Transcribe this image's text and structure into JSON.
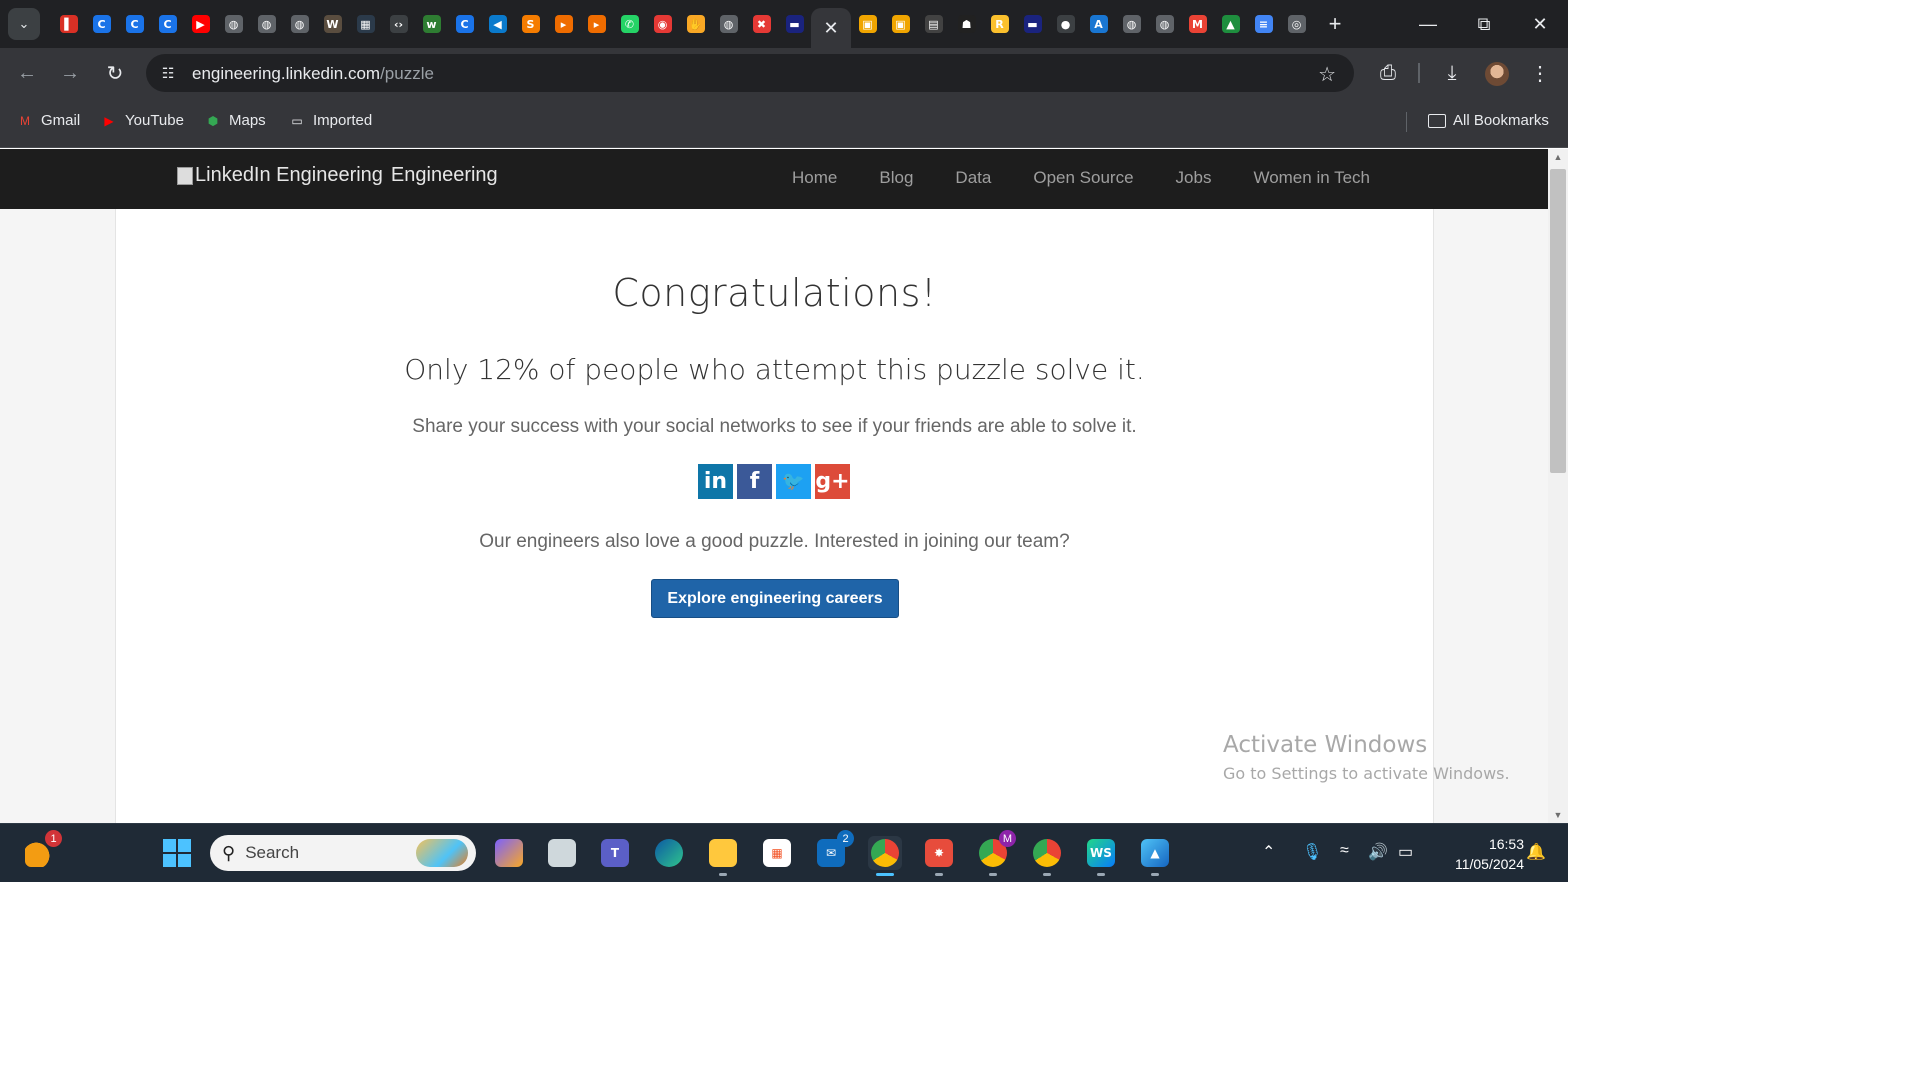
{
  "browser": {
    "tab_strip": {
      "tab_search_label": "⌄",
      "new_tab_label": "+",
      "active_tab_close": "✕",
      "tab_favicons_before": [
        {
          "icon": "pdf-icon",
          "glyph": "▌",
          "color": "#d93025"
        },
        {
          "icon": "c-icon",
          "glyph": "C",
          "color": "#1a73e8"
        },
        {
          "icon": "c-icon",
          "glyph": "C",
          "color": "#1a73e8"
        },
        {
          "icon": "c-icon",
          "glyph": "C",
          "color": "#1a73e8"
        },
        {
          "icon": "youtube-icon",
          "glyph": "▶",
          "color": "#ff0000"
        },
        {
          "icon": "globe-icon",
          "glyph": "◍",
          "color": "#5f6368"
        },
        {
          "icon": "globe-icon",
          "glyph": "◍",
          "color": "#5f6368"
        },
        {
          "icon": "globe-icon",
          "glyph": "◍",
          "color": "#5f6368"
        },
        {
          "icon": "site-icon",
          "glyph": "W",
          "color": "#5a4d3f"
        },
        {
          "icon": "site-icon",
          "glyph": "▦",
          "color": "#2b3a4a"
        },
        {
          "icon": "code-icon",
          "glyph": "‹›",
          "color": "#3c4043"
        },
        {
          "icon": "w-icon",
          "glyph": "w",
          "color": "#2e7d32"
        },
        {
          "icon": "c-icon",
          "glyph": "C",
          "color": "#1a73e8"
        },
        {
          "icon": "vscode-icon",
          "glyph": "◀",
          "color": "#0a7acc"
        },
        {
          "icon": "s-icon",
          "glyph": "S",
          "color": "#f57c00"
        },
        {
          "icon": "arrow-icon",
          "glyph": "▸",
          "color": "#ef6c00"
        },
        {
          "icon": "arrow-icon",
          "glyph": "▸",
          "color": "#ef6c00"
        },
        {
          "icon": "whatsapp-icon",
          "glyph": "✆",
          "color": "#25d366"
        },
        {
          "icon": "record-icon",
          "glyph": "◉",
          "color": "#e53935"
        },
        {
          "icon": "hand-icon",
          "glyph": "✋",
          "color": "#f9a825"
        },
        {
          "icon": "globe-icon",
          "glyph": "◍",
          "color": "#5f6368"
        },
        {
          "icon": "x-icon",
          "glyph": "✖",
          "color": "#e53935"
        },
        {
          "icon": "site-icon",
          "glyph": "▬",
          "color": "#1a237e"
        }
      ],
      "tab_favicons_after": [
        {
          "icon": "site-icon",
          "glyph": "▣",
          "color": "#f0a500"
        },
        {
          "icon": "site-icon",
          "glyph": "▣",
          "color": "#f0a500"
        },
        {
          "icon": "site-icon",
          "glyph": "▤",
          "color": "#424242"
        },
        {
          "icon": "site-icon",
          "glyph": "☗",
          "color": "#212121"
        },
        {
          "icon": "r-icon",
          "glyph": "R",
          "color": "#fbc02d"
        },
        {
          "icon": "site-icon",
          "glyph": "▬",
          "color": "#1a237e"
        },
        {
          "icon": "github-icon",
          "glyph": "●",
          "color": "#3c4043"
        },
        {
          "icon": "a-icon",
          "glyph": "A",
          "color": "#1976d2"
        },
        {
          "icon": "globe-icon",
          "glyph": "◍",
          "color": "#5f6368"
        },
        {
          "icon": "globe-icon",
          "glyph": "◍",
          "color": "#5f6368"
        },
        {
          "icon": "gmail-icon",
          "glyph": "M",
          "color": "#ea4335"
        },
        {
          "icon": "drive-icon",
          "glyph": "▲",
          "color": "#1e8e3e"
        },
        {
          "icon": "docs-icon",
          "glyph": "≡",
          "color": "#4285f4"
        },
        {
          "icon": "chrome-icon",
          "glyph": "◎",
          "color": "#5f6368"
        }
      ]
    },
    "url_host": "engineering.linkedin.com",
    "url_path": "/puzzle",
    "bookmarks": [
      {
        "label": "Gmail",
        "icon": "gmail-icon",
        "glyph": "M",
        "color": "#ea4335"
      },
      {
        "label": "YouTube",
        "icon": "youtube-icon",
        "glyph": "▶",
        "color": "#ff0000"
      },
      {
        "label": "Maps",
        "icon": "maps-icon",
        "glyph": "⬢",
        "color": "#34a853"
      },
      {
        "label": "Imported",
        "icon": "folder-icon",
        "glyph": "▭",
        "color": "#e8eaed"
      }
    ],
    "all_bookmarks_label": "All Bookmarks"
  },
  "site": {
    "brand_alt": "LinkedIn Engineering",
    "brand_text": "Engineering",
    "nav": [
      "Home",
      "Blog",
      "Data",
      "Open Source",
      "Jobs",
      "Women in Tech"
    ],
    "heading": "Congratulations!",
    "stat_text": "Only 12% of people who attempt this puzzle solve it.",
    "share_text": "Share your success with your social networks to see if your friends are able to solve it.",
    "social": [
      {
        "name": "linkedin",
        "glyph": "in",
        "color": "#0e76a8"
      },
      {
        "name": "facebook",
        "glyph": "f",
        "color": "#3b5998"
      },
      {
        "name": "twitter",
        "glyph": "🐦",
        "color": "#1da1f2"
      },
      {
        "name": "google-plus",
        "glyph": "g+",
        "color": "#dd4b39"
      }
    ],
    "puzzle_text": "Our engineers also love a good puzzle. Interested in joining our team?",
    "cta_label": "Explore engineering careers"
  },
  "watermark": {
    "title": "Activate Windows",
    "subtitle": "Go to Settings to activate Windows."
  },
  "taskbar": {
    "search_label": "Search",
    "weather_badge": "1",
    "mail_badge": "2",
    "chrome_profile_badge": "M",
    "time": "16:53",
    "date": "11/05/2024"
  }
}
